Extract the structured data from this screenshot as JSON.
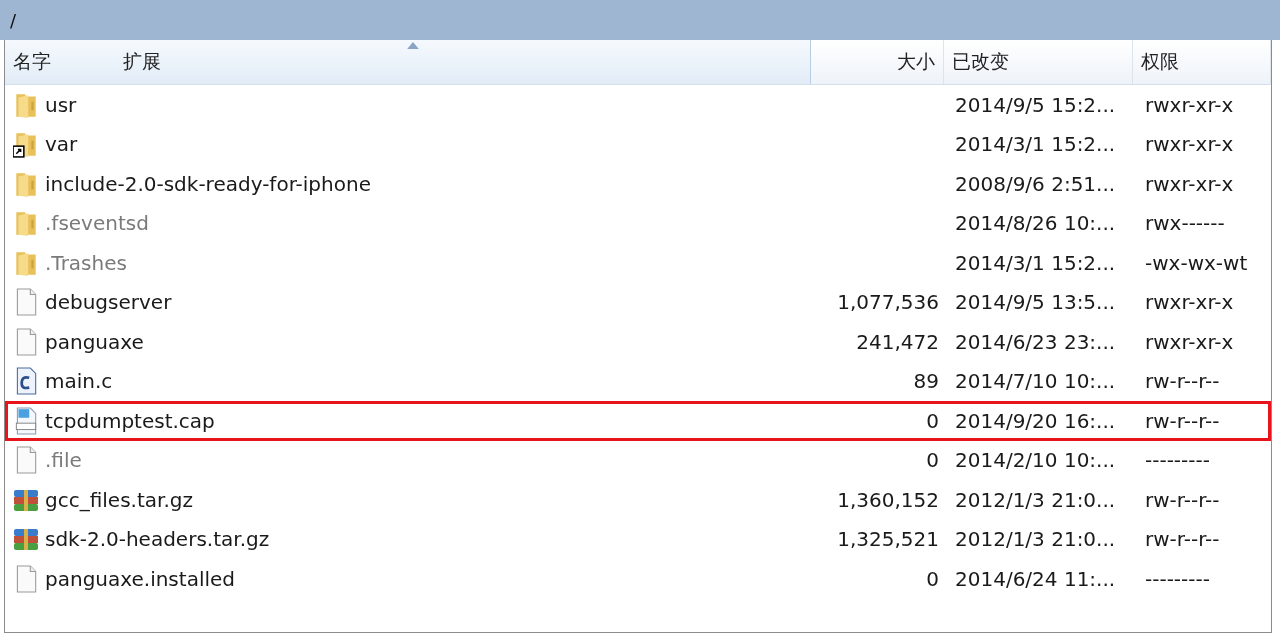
{
  "path": "/",
  "columns": [
    {
      "label": "名字",
      "sorted": false
    },
    {
      "label": "扩展",
      "sorted": true
    },
    {
      "label": "大小",
      "sorted": false
    },
    {
      "label": "已改变",
      "sorted": false
    },
    {
      "label": "权限",
      "sorted": false
    }
  ],
  "rows": [
    {
      "kind": "folder",
      "name": "usr",
      "size": "",
      "modified": "2014/9/5 15:2...",
      "permissions": "rwxr-xr-x",
      "hidden": false,
      "highlighted": false
    },
    {
      "kind": "folder-link",
      "name": "var",
      "size": "",
      "modified": "2014/3/1 15:2...",
      "permissions": "rwxr-xr-x",
      "hidden": false,
      "highlighted": false
    },
    {
      "kind": "folder",
      "name": "include-2.0-sdk-ready-for-iphone",
      "size": "",
      "modified": "2008/9/6 2:51...",
      "permissions": "rwxr-xr-x",
      "hidden": false,
      "highlighted": false
    },
    {
      "kind": "folder",
      "name": ".fseventsd",
      "size": "",
      "modified": "2014/8/26 10:...",
      "permissions": "rwx------",
      "hidden": true,
      "highlighted": false
    },
    {
      "kind": "folder",
      "name": ".Trashes",
      "size": "",
      "modified": "2014/3/1 15:2...",
      "permissions": "-wx-wx-wt",
      "hidden": true,
      "highlighted": false
    },
    {
      "kind": "file",
      "name": "debugserver",
      "size": "1,077,536",
      "modified": "2014/9/5 13:5...",
      "permissions": "rwxr-xr-x",
      "hidden": false,
      "highlighted": false
    },
    {
      "kind": "file",
      "name": "panguaxe",
      "size": "241,472",
      "modified": "2014/6/23 23:...",
      "permissions": "rwxr-xr-x",
      "hidden": false,
      "highlighted": false
    },
    {
      "kind": "c-file",
      "name": "main.c",
      "size": "89",
      "modified": "2014/7/10 10:...",
      "permissions": "rw-r--r--",
      "hidden": false,
      "highlighted": false
    },
    {
      "kind": "binary-file",
      "name": "tcpdumptest.cap",
      "size": "0",
      "modified": "2014/9/20 16:...",
      "permissions": "rw-r--r--",
      "hidden": false,
      "highlighted": true
    },
    {
      "kind": "file",
      "name": ".file",
      "size": "0",
      "modified": "2014/2/10 10:...",
      "permissions": "---------",
      "hidden": true,
      "highlighted": false
    },
    {
      "kind": "archive",
      "name": "gcc_files.tar.gz",
      "size": "1,360,152",
      "modified": "2012/1/3 21:0...",
      "permissions": "rw-r--r--",
      "hidden": false,
      "highlighted": false
    },
    {
      "kind": "archive",
      "name": "sdk-2.0-headers.tar.gz",
      "size": "1,325,521",
      "modified": "2012/1/3 21:0...",
      "permissions": "rw-r--r--",
      "hidden": false,
      "highlighted": false
    },
    {
      "kind": "file",
      "name": "panguaxe.installed",
      "size": "0",
      "modified": "2014/6/24 11:...",
      "permissions": "---------",
      "hidden": false,
      "highlighted": false
    }
  ]
}
